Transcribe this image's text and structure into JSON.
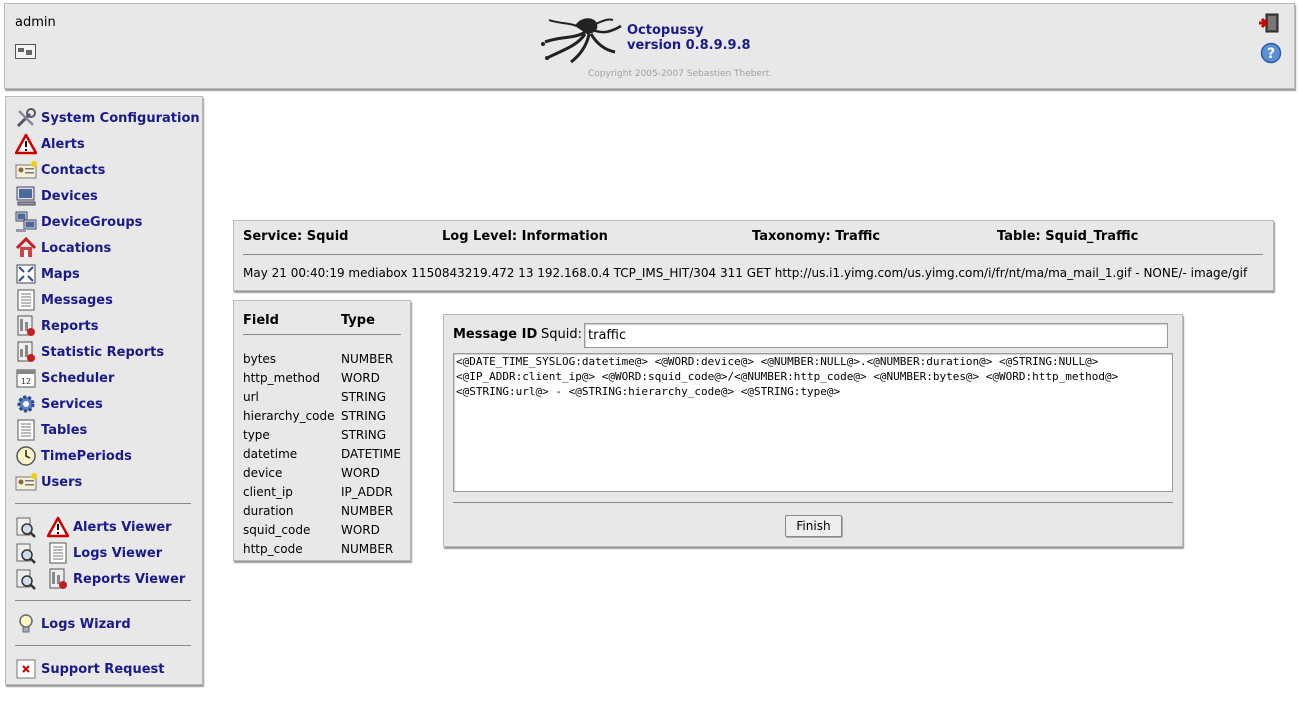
{
  "header": {
    "username": "admin",
    "app_name": "Octopussy",
    "version": "version 0.8.9.9.8",
    "copyright": "Copyright 2005-2007 Sebastien Thebert."
  },
  "sidebar": {
    "items": [
      {
        "label": "System Configuration",
        "icon": "tools-icon"
      },
      {
        "label": "Alerts",
        "icon": "warning-icon"
      },
      {
        "label": "Contacts",
        "icon": "contact-card-icon"
      },
      {
        "label": "Devices",
        "icon": "computer-icon"
      },
      {
        "label": "DeviceGroups",
        "icon": "computer-group-icon"
      },
      {
        "label": "Locations",
        "icon": "house-icon"
      },
      {
        "label": "Maps",
        "icon": "map-icon"
      },
      {
        "label": "Messages",
        "icon": "document-icon"
      },
      {
        "label": "Reports",
        "icon": "report-icon"
      },
      {
        "label": "Statistic Reports",
        "icon": "statistic-report-icon"
      },
      {
        "label": "Scheduler",
        "icon": "calendar-icon"
      },
      {
        "label": "Services",
        "icon": "gear-icon"
      },
      {
        "label": "Tables",
        "icon": "table-icon"
      },
      {
        "label": "TimePeriods",
        "icon": "clock-icon"
      },
      {
        "label": "Users",
        "icon": "user-card-icon"
      }
    ],
    "viewers": [
      {
        "label": "Alerts Viewer"
      },
      {
        "label": "Logs Viewer"
      },
      {
        "label": "Reports Viewer"
      }
    ],
    "wizard": "Logs Wizard",
    "support": "Support Request"
  },
  "service": {
    "service": "Service: Squid",
    "log_level": "Log Level: Information",
    "taxonomy": "Taxonomy: Traffic",
    "table": "Table: Squid_Traffic",
    "log_line": "May 21 00:40:19 mediabox 1150843219.472 13 192.168.0.4 TCP_IMS_HIT/304 311 GET http://us.i1.yimg.com/us.yimg.com/i/fr/nt/ma/ma_mail_1.gif - NONE/- image/gif"
  },
  "fields": {
    "headers": [
      "Field",
      "Type"
    ],
    "rows": [
      [
        "bytes",
        "NUMBER"
      ],
      [
        "http_method",
        "WORD"
      ],
      [
        "url",
        "STRING"
      ],
      [
        "hierarchy_code",
        "STRING"
      ],
      [
        "type",
        "STRING"
      ],
      [
        "datetime",
        "DATETIME"
      ],
      [
        "device",
        "WORD"
      ],
      [
        "client_ip",
        "IP_ADDR"
      ],
      [
        "duration",
        "NUMBER"
      ],
      [
        "squid_code",
        "WORD"
      ],
      [
        "http_code",
        "NUMBER"
      ]
    ]
  },
  "message": {
    "label": "Message ID",
    "prefix": "Squid:",
    "id_value": "traffic",
    "pattern": "<@DATE_TIME_SYSLOG:datetime@> <@WORD:device@> <@NUMBER:NULL@>.<@NUMBER:duration@> <@STRING:NULL@> <@IP_ADDR:client_ip@> <@WORD:squid_code@>/<@NUMBER:http_code@> <@NUMBER:bytes@> <@WORD:http_method@> <@STRING:url@> - <@STRING:hierarchy_code@> <@STRING:type@>",
    "finish_label": "Finish"
  }
}
